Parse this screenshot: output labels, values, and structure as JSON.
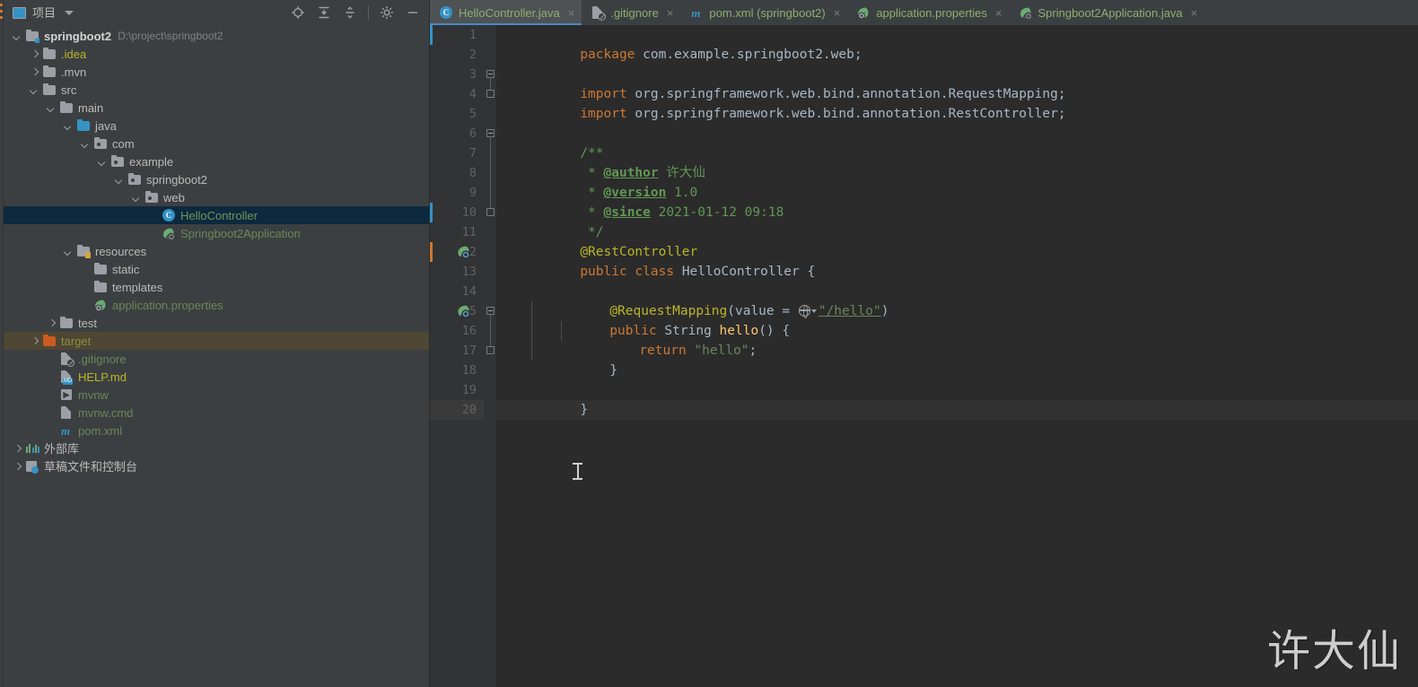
{
  "panel": {
    "title": "项目",
    "icons": {
      "window": "project-window-icon",
      "dropdown": "chevron-down-icon",
      "locate": "locate-target-icon",
      "expand_all": "expand-all-icon",
      "collapse_all": "collapse-all-icon",
      "settings": "gear-icon",
      "hide": "minimize-icon"
    }
  },
  "tree": [
    {
      "indent": 0,
      "arrow": "down",
      "icon": "module-folder",
      "label": "springboot2",
      "path": "D:\\project\\springboot2",
      "style": "bold",
      "color": "grey"
    },
    {
      "indent": 1,
      "arrow": "right",
      "icon": "folder-grey",
      "label": ".idea",
      "color": "yellow"
    },
    {
      "indent": 1,
      "arrow": "right",
      "icon": "folder-grey",
      "label": ".mvn",
      "color": "grey"
    },
    {
      "indent": 1,
      "arrow": "down",
      "icon": "folder-grey",
      "label": "src",
      "color": "grey"
    },
    {
      "indent": 2,
      "arrow": "down",
      "icon": "folder-grey",
      "label": "main",
      "color": "grey"
    },
    {
      "indent": 3,
      "arrow": "down",
      "icon": "folder-blue",
      "label": "java",
      "color": "grey"
    },
    {
      "indent": 4,
      "arrow": "down",
      "icon": "package",
      "label": "com",
      "color": "grey"
    },
    {
      "indent": 5,
      "arrow": "down",
      "icon": "package",
      "label": "example",
      "color": "grey"
    },
    {
      "indent": 6,
      "arrow": "down",
      "icon": "package",
      "label": "springboot2",
      "color": "grey"
    },
    {
      "indent": 7,
      "arrow": "down",
      "icon": "package",
      "label": "web",
      "color": "grey"
    },
    {
      "indent": 8,
      "arrow": "none",
      "icon": "java-class",
      "label": "HelloController",
      "color": "hl",
      "selected": true
    },
    {
      "indent": 8,
      "arrow": "none",
      "icon": "spring-boot",
      "label": "Springboot2Application",
      "color": "green"
    },
    {
      "indent": 3,
      "arrow": "down",
      "icon": "folder-resources",
      "label": "resources",
      "color": "grey"
    },
    {
      "indent": 4,
      "arrow": "none",
      "icon": "folder-grey",
      "label": "static",
      "color": "grey"
    },
    {
      "indent": 4,
      "arrow": "none",
      "icon": "folder-grey",
      "label": "templates",
      "color": "grey"
    },
    {
      "indent": 4,
      "arrow": "none",
      "icon": "spring-props",
      "label": "application.properties",
      "color": "green"
    },
    {
      "indent": 2,
      "arrow": "right",
      "icon": "folder-grey",
      "label": "test",
      "color": "grey"
    },
    {
      "indent": 1,
      "arrow": "right",
      "icon": "folder-orange",
      "label": "target",
      "color": "olive",
      "highlight": "target"
    },
    {
      "indent": 2,
      "arrow": "none",
      "icon": "gitignore",
      "label": ".gitignore",
      "color": "green"
    },
    {
      "indent": 2,
      "arrow": "none",
      "icon": "markdown",
      "label": "HELP.md",
      "color": "yellow"
    },
    {
      "indent": 2,
      "arrow": "none",
      "icon": "shell-script",
      "label": "mvnw",
      "color": "green"
    },
    {
      "indent": 2,
      "arrow": "none",
      "icon": "cmd-script",
      "label": "mvnw.cmd",
      "color": "green"
    },
    {
      "indent": 2,
      "arrow": "none",
      "icon": "maven-xml",
      "label": "pom.xml",
      "color": "green"
    },
    {
      "indent": 0,
      "arrow": "right",
      "icon": "external-libs",
      "label": "外部库",
      "color": "grey"
    },
    {
      "indent": 0,
      "arrow": "right",
      "icon": "scratches",
      "label": "草稿文件和控制台",
      "color": "grey"
    }
  ],
  "tabs": [
    {
      "label": "HelloController.java",
      "icon": "java-class",
      "active": true,
      "close": "×"
    },
    {
      "label": ".gitignore",
      "icon": "gitignore",
      "active": false,
      "close": "×"
    },
    {
      "label": "pom.xml (springboot2)",
      "icon": "maven-xml",
      "active": false,
      "close": "×"
    },
    {
      "label": "application.properties",
      "icon": "spring-props",
      "active": false,
      "close": "×"
    },
    {
      "label": "Springboot2Application.java",
      "icon": "spring-boot",
      "active": false,
      "close": "×"
    }
  ],
  "editor": {
    "line_numbers": [
      "1",
      "2",
      "3",
      "4",
      "5",
      "6",
      "7",
      "8",
      "9",
      "10",
      "11",
      "12",
      "13",
      "14",
      "15",
      "16",
      "17",
      "18",
      "19",
      "20"
    ],
    "current_line": "20",
    "code": {
      "l1_kw": "package",
      "l1_rest": " com.example.springboot2.web;",
      "l3_kw": "import",
      "l3_rest": " org.springframework.web.bind.annotation.RequestMapping;",
      "l4_kw": "import",
      "l4_rest": " org.springframework.web.bind.annotation.RestController;",
      "l6": "/**",
      "l7_star": " * ",
      "l7_tag": "@author",
      "l7_val": " 许大仙",
      "l8_star": " * ",
      "l8_tag": "@version",
      "l8_val": " 1.0",
      "l9_star": " * ",
      "l9_tag": "@since",
      "l9_val": " 2021-01-12 09:18",
      "l10": " */",
      "l11": "@RestController",
      "l12_kw": "public class ",
      "l12_cls": "HelloController",
      "l12_brace": " {",
      "l14_ann": "@RequestMapping",
      "l14_open": "(value = ",
      "l14_str": "\"/hello\"",
      "l14_close": ")",
      "l15_kw": "public ",
      "l15_type": "String ",
      "l15_fn": "hello",
      "l15_rest": "() {",
      "l16_kw": "return ",
      "l16_str": "\"hello\"",
      "l16_semi": ";",
      "l17": "}",
      "l19": "}"
    },
    "gutter_icons": {
      "line12": "spring-bean-icon",
      "line15": "spring-request-mapping-icon"
    },
    "url_icon": "globe-icon",
    "url_dropdown": "chevron-down-icon",
    "caret": "text-cursor"
  },
  "watermark": "许大仙",
  "colors": {
    "panel_bg": "#3c3f41",
    "editor_bg": "#2b2b2b",
    "gutter_bg": "#313335",
    "selection": "#0d293e",
    "target_highlight": "#4e4734",
    "accent_blue": "#3592c4",
    "tab_active": "#4e5254",
    "tab_underline": "#4a88c7",
    "keyword": "#cc7832",
    "string": "#6a8759",
    "comment": "#629755",
    "annotation": "#bbb529",
    "method": "#ffc66d",
    "text": "#a9b7c6"
  }
}
